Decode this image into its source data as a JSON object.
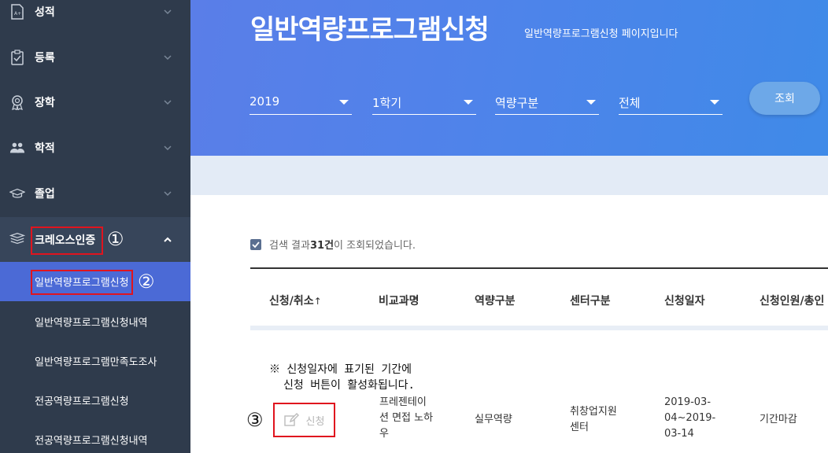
{
  "sidebar": {
    "items": [
      {
        "label": "성적",
        "icon": "grade-document-icon"
      },
      {
        "label": "등록",
        "icon": "registration-check-icon"
      },
      {
        "label": "장학",
        "icon": "scholarship-medal-icon"
      },
      {
        "label": "학적",
        "icon": "people-icon"
      },
      {
        "label": "졸업",
        "icon": "graduation-cap-icon"
      }
    ],
    "cross_label": "크레오스인증",
    "sub_items": [
      {
        "label": "일반역량프로그램신청"
      },
      {
        "label": "일반역량프로그램신청내역"
      },
      {
        "label": "일반역량프로그램만족도조사"
      },
      {
        "label": "전공역량프로그램신청"
      },
      {
        "label": "전공역량프로그램신청내역"
      }
    ],
    "annotation_1": "①",
    "annotation_2": "②"
  },
  "header": {
    "title": "일반역량프로그램신청",
    "subtitle": "일반역량프로그램신청 페이지입니다",
    "filters": {
      "year": "2019",
      "semester": "1학기",
      "category": "역량구분",
      "all": "전체"
    },
    "search_label": "조회"
  },
  "results": {
    "prefix": "검색 결과 ",
    "count": "31건",
    "suffix": "이 조회되었습니다."
  },
  "table": {
    "columns": [
      "신청/취소",
      "비교과명",
      "역량구분",
      "센터구분",
      "신청일자",
      "신청인원/총인"
    ],
    "sort_indicator": "↑",
    "note_line1": "※ 신청일자에 표기된 기간에",
    "note_line2": "신청 버튼이 활성화됩니다.",
    "row": {
      "apply_label": "신청",
      "program_lines": [
        "프레젠테이",
        "션 면접 노하",
        "우"
      ],
      "competency": "실무역량",
      "center_lines": [
        "취창업지원",
        "센터"
      ],
      "date_lines": [
        "2019-03-",
        "04~2019-",
        "03-14"
      ],
      "status": "기간마감"
    },
    "annotation_3": "③"
  },
  "colors": {
    "sidebar_bg": "#2f3b4c",
    "active_bg": "#4b6ad6",
    "header_blue": "#4f83ea",
    "highlight_red": "#e0141e"
  }
}
